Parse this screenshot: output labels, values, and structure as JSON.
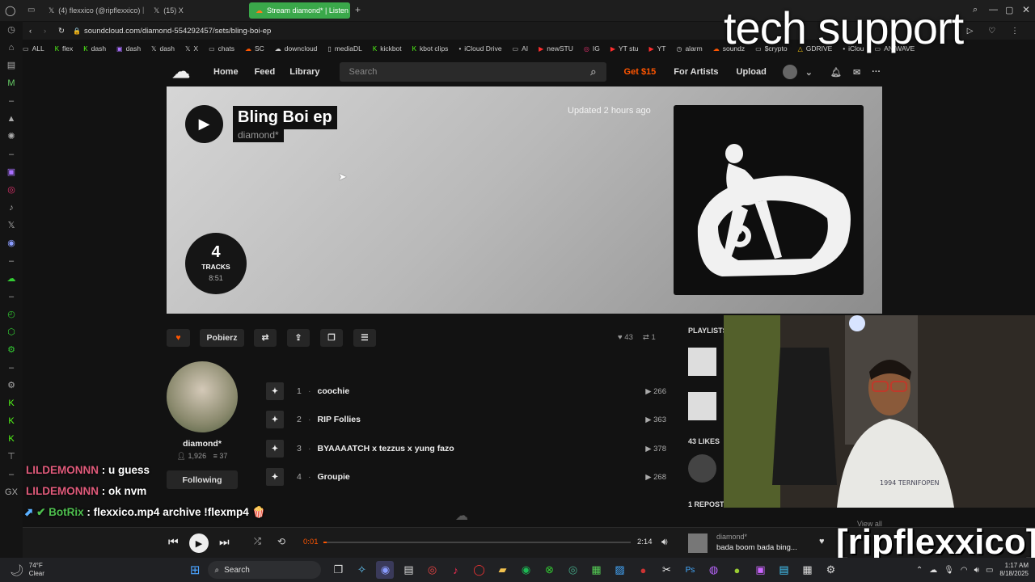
{
  "browser": {
    "tabs": [
      {
        "label": "(4) flexxico (@ripflexxico)",
        "icon": "x-logo-icon"
      },
      {
        "label": "(15) X",
        "icon": "x-logo-icon"
      },
      {
        "label": "Stream diamond* | Listen",
        "icon": "soundcloud-icon",
        "active": true
      }
    ],
    "new_tab": "+",
    "url": "soundcloud.com/diamond-554292457/sets/bling-boi-ep",
    "bookmarks": [
      {
        "label": "ALL",
        "icon": "folder-icon"
      },
      {
        "label": "flex",
        "icon": "kick-icon"
      },
      {
        "label": "dash",
        "icon": "kick-icon"
      },
      {
        "label": "dash",
        "icon": "twitch-icon"
      },
      {
        "label": "dash",
        "icon": "x-logo-icon"
      },
      {
        "label": "X",
        "icon": "x-logo-icon"
      },
      {
        "label": "chats",
        "icon": "folder-icon"
      },
      {
        "label": "SC",
        "icon": "soundcloud-icon"
      },
      {
        "label": "downcloud",
        "icon": "cloud-icon"
      },
      {
        "label": "mediaDL",
        "icon": "file-icon"
      },
      {
        "label": "kickbot",
        "icon": "kick-icon"
      },
      {
        "label": "kbot clips",
        "icon": "kick-icon"
      },
      {
        "label": "iCloud Drive",
        "icon": "apple-icon"
      },
      {
        "label": "AI",
        "icon": "folder-icon"
      },
      {
        "label": "newSTU",
        "icon": "youtube-icon"
      },
      {
        "label": "IG",
        "icon": "instagram-icon"
      },
      {
        "label": "YT stu",
        "icon": "youtube-icon"
      },
      {
        "label": "YT",
        "icon": "youtube-icon"
      },
      {
        "label": "alarm",
        "icon": "clock-icon"
      },
      {
        "label": "soundz",
        "icon": "soundcloud-icon"
      },
      {
        "label": "$crypto",
        "icon": "folder-icon"
      },
      {
        "label": "GDRIVE",
        "icon": "drive-icon"
      },
      {
        "label": "iClou",
        "icon": "apple-icon"
      },
      {
        "label": "ANIWAVE",
        "icon": "folder-icon"
      }
    ]
  },
  "nav": {
    "home": "Home",
    "feed": "Feed",
    "library": "Library",
    "search_placeholder": "Search",
    "get": "Get $15",
    "for_artists": "For Artists",
    "upload": "Upload"
  },
  "playlist": {
    "title": "Bling Boi ep",
    "artist": "diamond*",
    "updated": "Updated 2 hours ago",
    "track_count": "4",
    "tracks_label": "TRACKS",
    "duration": "8:51"
  },
  "actions": {
    "download": "Pobierz",
    "likes": "43",
    "reposts": "1"
  },
  "artist": {
    "name": "diamond*",
    "followers": "1,926",
    "tracks": "37",
    "following_btn": "Following"
  },
  "tracks": [
    {
      "num": "1",
      "title": "coochie",
      "plays": "266"
    },
    {
      "num": "2",
      "title": "RIP Follies",
      "plays": "363"
    },
    {
      "num": "3",
      "title": "BYAAAATCH x tezzus x yung fazo",
      "plays": "378"
    },
    {
      "num": "4",
      "title": "Groupie",
      "plays": "268"
    }
  ],
  "sidebar": {
    "playlists": "PLAYLISTS",
    "likes": "43 LIKES",
    "reposts": "1 REPOST",
    "view_all": "View all"
  },
  "player": {
    "elapsed": "0:01",
    "total": "2:14",
    "progress": 0.01,
    "now_artist": "diamond*",
    "now_title": "bada boom bada bing..."
  },
  "chat": [
    {
      "user": "LILDEMONNN",
      "msg": "u guess",
      "color": "#e05a7a"
    },
    {
      "user": "LILDEMONNN",
      "msg": "ok nvm",
      "color": "#e05a7a"
    },
    {
      "user": "BotRix",
      "msg": "flexxico.mp4 archive !flexmp4 🍿",
      "color": "#4fc14f"
    }
  ],
  "overlay": {
    "top": "tech support",
    "bottom": "[ripflexxico]"
  },
  "taskbar": {
    "weather_temp": "74°F",
    "weather_desc": "Clear",
    "search": "Search",
    "time": "1:17 AM",
    "date": "8/18/2025"
  }
}
